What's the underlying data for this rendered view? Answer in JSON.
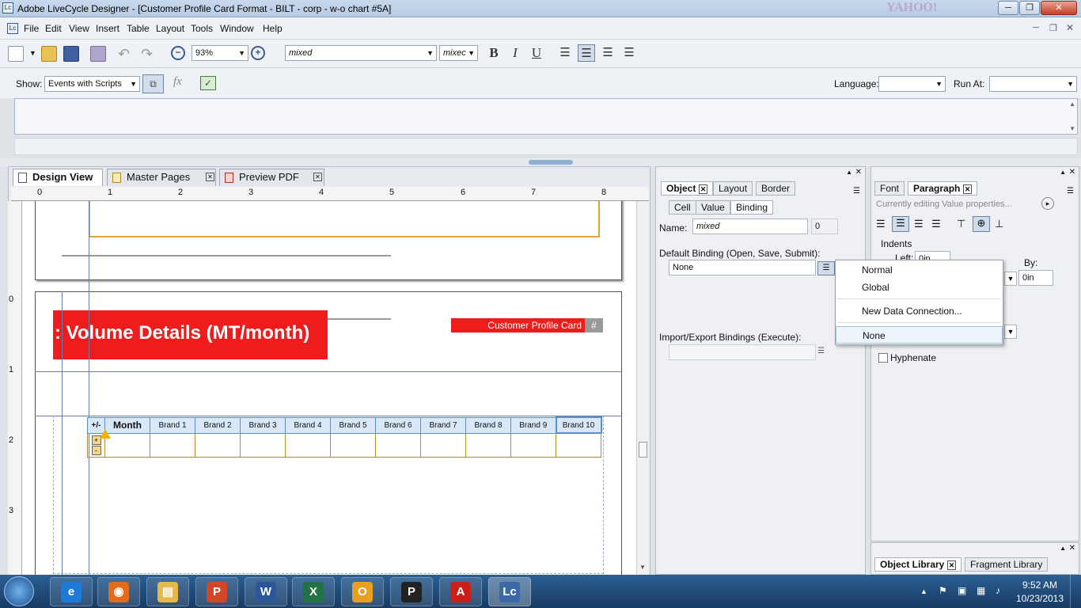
{
  "window": {
    "title": "Adobe LiveCycle Designer - [Customer Profile Card Format - BILT - corp - w-o chart #5A]",
    "bg_title_right": "YAHOO!"
  },
  "menu": [
    "File",
    "Edit",
    "View",
    "Insert",
    "Table",
    "Layout",
    "Tools",
    "Window",
    "Help"
  ],
  "toolbar": {
    "zoom": "93%",
    "font": "mixed",
    "size": "mixec",
    "bold": "B",
    "italic": "I",
    "underline": "U"
  },
  "scriptbar": {
    "show_label": "Show:",
    "show_value": "Events with Scripts",
    "language_label": "Language:",
    "language_value": "",
    "runat_label": "Run At:",
    "runat_value": ""
  },
  "doc_tabs": [
    {
      "label": "Design View"
    },
    {
      "label": "Master Pages"
    },
    {
      "label": "Preview PDF"
    }
  ],
  "ruler": {
    "h": [
      "0",
      "1",
      "2",
      "3",
      "4",
      "5",
      "6",
      "7",
      "8"
    ],
    "v": [
      "0",
      "1",
      "2",
      "3"
    ]
  },
  "canvas": {
    "volume_title": ": Volume Details (MT/month)",
    "customer_card": "Customer Profile Card",
    "hash": "#",
    "table_headers": [
      "+/-",
      "Month",
      "Brand 1",
      "Brand 2",
      "Brand 3",
      "Brand 4",
      "Brand 5",
      "Brand 6",
      "Brand 7",
      "Brand 8",
      "Brand 9",
      "Brand 10"
    ],
    "plus": "+",
    "minus": "-"
  },
  "object_panel": {
    "tabs": [
      "Object",
      "Layout",
      "Border"
    ],
    "subtabs": [
      "Cell",
      "Value",
      "Binding"
    ],
    "name_label": "Name:",
    "name_value": "mixed",
    "name_count": "0",
    "default_binding_label": "Default Binding (Open, Save, Submit):",
    "default_binding_value": "None",
    "import_export_label": "Import/Export Bindings (Execute):"
  },
  "paragraph_panel": {
    "tabs": [
      "Font",
      "Paragraph"
    ],
    "editing_note": "Currently editing Value properties...",
    "indents_label": "Indents",
    "left_label": "Left:",
    "left_value": "0in",
    "by_label": "By:",
    "by_value": "0in",
    "hyphenate_label": "Hyphenate"
  },
  "dropdown": {
    "items": [
      "Normal",
      "Global",
      "New Data Connection...",
      "None"
    ],
    "selected": "None"
  },
  "library_panel": {
    "tabs": [
      "Object Library",
      "Fragment Library"
    ]
  },
  "taskbar": {
    "apps": [
      {
        "icon": "ie-icon",
        "glyph": "e",
        "color": "#1f7ad6"
      },
      {
        "icon": "firefox-icon",
        "glyph": "◉",
        "color": "#e36b1c"
      },
      {
        "icon": "explorer-icon",
        "glyph": "▤",
        "color": "#e6b84a"
      },
      {
        "icon": "powerpoint-icon",
        "glyph": "P",
        "color": "#d24726"
      },
      {
        "icon": "word-icon",
        "glyph": "W",
        "color": "#2b579a"
      },
      {
        "icon": "excel-icon",
        "glyph": "X",
        "color": "#217346"
      },
      {
        "icon": "outlook-icon",
        "glyph": "O",
        "color": "#e8a11e"
      },
      {
        "icon": "p-app-icon",
        "glyph": "P",
        "color": "#222222"
      },
      {
        "icon": "acrobat-icon",
        "glyph": "A",
        "color": "#c9201a"
      },
      {
        "icon": "livecycle-icon",
        "glyph": "Lc",
        "color": "#3c6aa8"
      }
    ],
    "time": "9:52 AM",
    "date": "10/23/2013"
  }
}
